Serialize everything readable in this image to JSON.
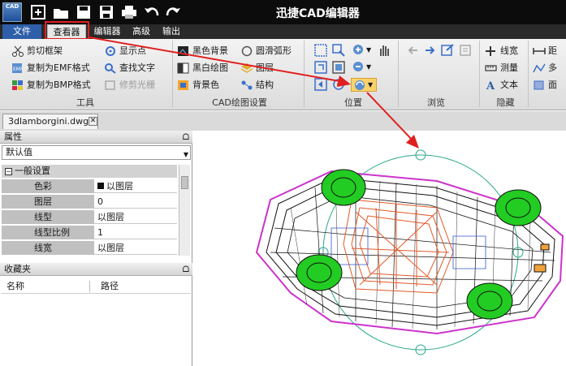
{
  "titlebar": {
    "title": "迅捷CAD编辑器",
    "app_icon_text": "CAD"
  },
  "menubar": {
    "items": [
      "文件",
      "查看器",
      "编辑器",
      "高级",
      "输出"
    ]
  },
  "ribbon": {
    "tools": {
      "items": [
        "剪切框架",
        "复制为EMF格式",
        "复制为BMP格式",
        "显示点",
        "查找文字",
        "修剪光栅"
      ],
      "label": "工具"
    },
    "cad_settings": {
      "items": [
        "黑色背景",
        "黑白绘图",
        "背景色",
        "圆滑弧形",
        "图层",
        "结构"
      ],
      "label": "CAD绘图设置"
    },
    "position": {
      "label": "位置"
    },
    "browse": {
      "label": "浏览"
    },
    "hide": {
      "items": [
        "线宽",
        "测量",
        "文本"
      ],
      "label": "隐藏"
    },
    "extra": {
      "items": [
        "距",
        "多",
        "面"
      ]
    }
  },
  "document": {
    "tab": "3dlamborgini.dwg"
  },
  "properties": {
    "header": "属性",
    "combo_value": "默认值",
    "group": "一般设置",
    "rows": [
      {
        "name": "色彩",
        "value": "以图层"
      },
      {
        "name": "图层",
        "value": "0"
      },
      {
        "name": "线型",
        "value": "以图层"
      },
      {
        "name": "线型比例",
        "value": "1"
      },
      {
        "name": "线宽",
        "value": "以图层"
      }
    ]
  },
  "favorites": {
    "header": "收藏夹",
    "columns": [
      "名称",
      "路径"
    ]
  },
  "colors": {
    "titlebar": "#0c0c0c",
    "menubar": "#2a2a2a",
    "file_menu": "#2e5fa8",
    "highlight": "#e02020",
    "wheel": "#22cc22",
    "wire_frame": "#111111",
    "outline": "#cc33cc",
    "interior": "#e05a2a",
    "rotation_circle": "#2aa88a"
  }
}
